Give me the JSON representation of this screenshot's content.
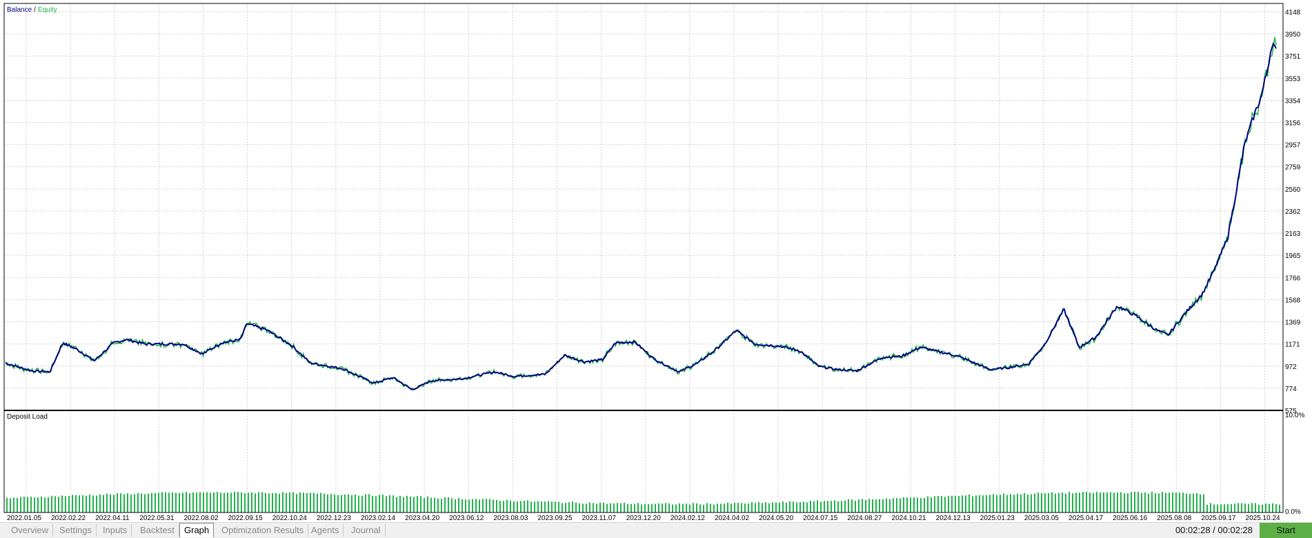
{
  "window": {
    "tab_active": "Graph"
  },
  "tabs": [
    {
      "label": "Overview"
    },
    {
      "label": "Settings"
    },
    {
      "label": "Inputs"
    },
    {
      "label": "Backtest"
    },
    {
      "label": "Graph"
    },
    {
      "label": "Optimization Results"
    },
    {
      "label": "Agents"
    },
    {
      "label": "Journal"
    }
  ],
  "status": {
    "timer": "00:02:28 / 00:02:28",
    "start_label": "Start"
  },
  "colors": {
    "balance": "#00007f",
    "equity": "#22b14c",
    "grid": "#d0d0d0",
    "start_button": "#5db046"
  },
  "chart_data": [
    {
      "type": "line",
      "legend": [
        "Balance",
        "/",
        "Equity"
      ],
      "series": [
        {
          "name": "Balance"
        },
        {
          "name": "Equity"
        }
      ],
      "ylim": [
        575,
        4148
      ],
      "y_ticks": [
        "4148",
        "3950",
        "3751",
        "3553",
        "3354",
        "3156",
        "2957",
        "2759",
        "2560",
        "2362",
        "2163",
        "1965",
        "1766",
        "1568",
        "1369",
        "1171",
        "972",
        "774",
        "575"
      ],
      "x_ticks": [
        "2022.01.05",
        "2022.02.22",
        "2022.04.11",
        "2022.05.31",
        "2022.08.02",
        "2022.09.15",
        "2022.10.24",
        "2022.12.23",
        "2023.02.14",
        "2023.04.20",
        "2023.06.12",
        "2023.08.03",
        "2023.09.25",
        "2023.11.07",
        "2023.12.20",
        "2024.02.12",
        "2024.04.02",
        "2024.05.20",
        "2024.07.15",
        "2024.08.27",
        "2024.10.21",
        "2024.12.13",
        "2025.01.23",
        "2025.03.05",
        "2025.04.17",
        "2025.06.16",
        "2025.08.08",
        "2025.09.17",
        "2025.10.24"
      ],
      "keypoints": [
        [
          0,
          1000
        ],
        [
          0.02,
          930
        ],
        [
          0.035,
          920
        ],
        [
          0.045,
          1180
        ],
        [
          0.055,
          1130
        ],
        [
          0.07,
          1020
        ],
        [
          0.085,
          1180
        ],
        [
          0.095,
          1210
        ],
        [
          0.11,
          1170
        ],
        [
          0.14,
          1170
        ],
        [
          0.155,
          1080
        ],
        [
          0.17,
          1180
        ],
        [
          0.185,
          1210
        ],
        [
          0.19,
          1350
        ],
        [
          0.205,
          1300
        ],
        [
          0.225,
          1160
        ],
        [
          0.24,
          1000
        ],
        [
          0.265,
          950
        ],
        [
          0.29,
          820
        ],
        [
          0.305,
          870
        ],
        [
          0.32,
          760
        ],
        [
          0.335,
          840
        ],
        [
          0.36,
          860
        ],
        [
          0.385,
          920
        ],
        [
          0.4,
          880
        ],
        [
          0.425,
          900
        ],
        [
          0.44,
          1070
        ],
        [
          0.455,
          1010
        ],
        [
          0.47,
          1030
        ],
        [
          0.48,
          1180
        ],
        [
          0.495,
          1190
        ],
        [
          0.51,
          1040
        ],
        [
          0.53,
          920
        ],
        [
          0.545,
          1000
        ],
        [
          0.56,
          1130
        ],
        [
          0.575,
          1290
        ],
        [
          0.59,
          1170
        ],
        [
          0.61,
          1150
        ],
        [
          0.625,
          1110
        ],
        [
          0.64,
          970
        ],
        [
          0.655,
          940
        ],
        [
          0.67,
          930
        ],
        [
          0.69,
          1050
        ],
        [
          0.705,
          1060
        ],
        [
          0.72,
          1140
        ],
        [
          0.735,
          1100
        ],
        [
          0.75,
          1060
        ],
        [
          0.775,
          940
        ],
        [
          0.79,
          960
        ],
        [
          0.805,
          990
        ],
        [
          0.818,
          1170
        ],
        [
          0.833,
          1480
        ],
        [
          0.845,
          1140
        ],
        [
          0.858,
          1230
        ],
        [
          0.875,
          1510
        ],
        [
          0.89,
          1420
        ],
        [
          0.905,
          1300
        ],
        [
          0.915,
          1250
        ],
        [
          0.928,
          1440
        ],
        [
          0.942,
          1620
        ],
        [
          0.952,
          1850
        ],
        [
          0.962,
          2130
        ],
        [
          0.968,
          2500
        ],
        [
          0.975,
          2950
        ],
        [
          0.982,
          3200
        ],
        [
          0.988,
          3380
        ],
        [
          0.993,
          3620
        ],
        [
          0.997,
          3880
        ],
        [
          1.0,
          3790
        ]
      ]
    },
    {
      "type": "bar",
      "title": "Deposit Load",
      "y_ticks": [
        "10.0%",
        "0.0%"
      ],
      "ylim": [
        0,
        10
      ],
      "values_range": [
        0.8,
        2.0
      ]
    }
  ]
}
